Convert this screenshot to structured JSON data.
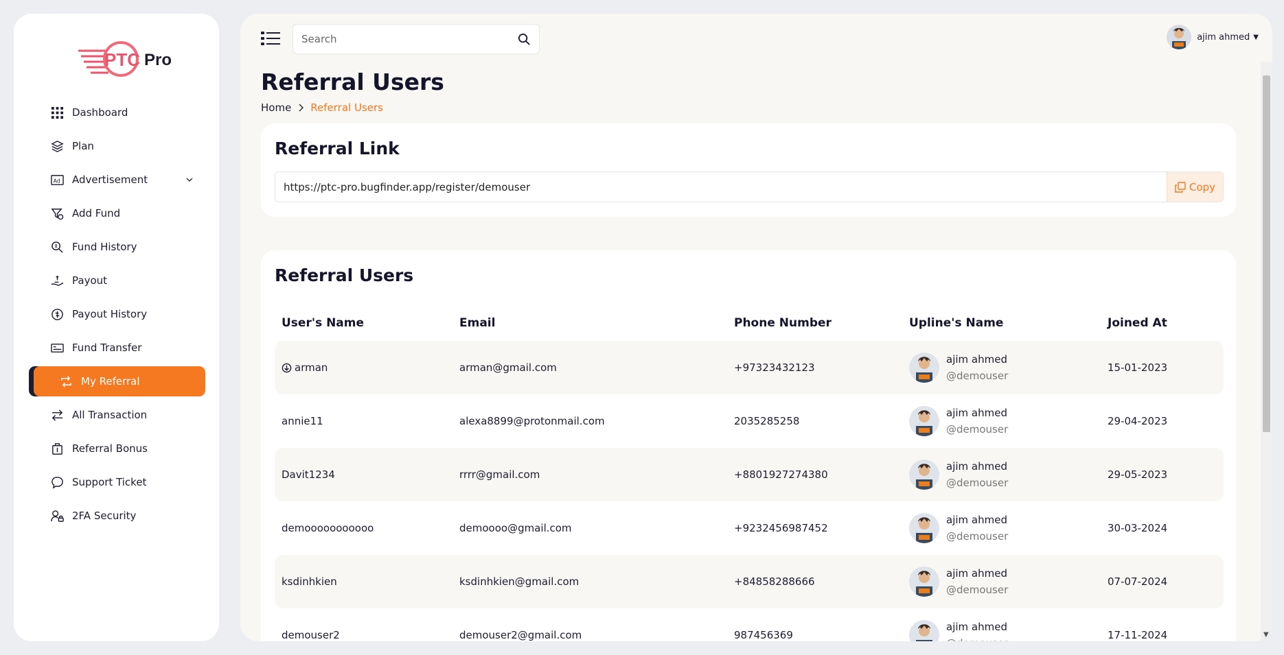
{
  "brand": {
    "logo_left": "PTC",
    "logo_right": "Pro",
    "accent": "#f47920",
    "dark": "#1c1c2e"
  },
  "sidebar": {
    "items": [
      {
        "label": "Dashboard",
        "icon": "grid-icon"
      },
      {
        "label": "Plan",
        "icon": "layers-icon"
      },
      {
        "label": "Advertisement",
        "icon": "ad-icon"
      },
      {
        "label": "Add Fund",
        "icon": "funnel-dollar-icon"
      },
      {
        "label": "Fund History",
        "icon": "search-dollar-icon"
      },
      {
        "label": "Payout",
        "icon": "hand-money-icon"
      },
      {
        "label": "Payout History",
        "icon": "coin-history-icon"
      },
      {
        "label": "Fund Transfer",
        "icon": "money-card-icon"
      },
      {
        "label": "My Referral",
        "icon": "referral-arrows-icon",
        "active": true
      },
      {
        "label": "All Transaction",
        "icon": "exchange-icon"
      },
      {
        "label": "Referral Bonus",
        "icon": "bonus-bag-icon"
      },
      {
        "label": "Support Ticket",
        "icon": "chat-icon"
      },
      {
        "label": "2FA Security",
        "icon": "user-lock-icon"
      }
    ]
  },
  "topbar": {
    "search_placeholder": "Search",
    "user_name": "ajim ahmed"
  },
  "page": {
    "title": "Referral Users",
    "breadcrumb_home": "Home",
    "breadcrumb_current": "Referral Users"
  },
  "referral_link": {
    "title": "Referral Link",
    "url": "https://ptc-pro.bugfinder.app/register/demouser",
    "copy_label": "Copy"
  },
  "referral_users": {
    "title": "Referral Users",
    "columns": [
      "User's Name",
      "Email",
      "Phone Number",
      "Upline's Name",
      "Joined At"
    ],
    "rows": [
      {
        "name": "arman",
        "email": "arman@gmail.com",
        "phone": "+97323432123",
        "upline_name": "ajim ahmed",
        "upline_handle": "@demouser",
        "joined": "15-01-2023",
        "has_icon": true
      },
      {
        "name": "annie11",
        "email": "alexa8899@protonmail.com",
        "phone": "2035285258",
        "upline_name": "ajim ahmed",
        "upline_handle": "@demouser",
        "joined": "29-04-2023"
      },
      {
        "name": "Davit1234",
        "email": "rrrr@gmail.com",
        "phone": "+8801927274380",
        "upline_name": "ajim ahmed",
        "upline_handle": "@demouser",
        "joined": "29-05-2023"
      },
      {
        "name": "demooooooooooo",
        "email": "demoooo@gmail.com",
        "phone": "+9232456987452",
        "upline_name": "ajim ahmed",
        "upline_handle": "@demouser",
        "joined": "30-03-2024"
      },
      {
        "name": "ksdinhkien",
        "email": "ksdinhkien@gmail.com",
        "phone": "+84858288666",
        "upline_name": "ajim ahmed",
        "upline_handle": "@demouser",
        "joined": "07-07-2024"
      },
      {
        "name": "demouser2",
        "email": "demouser2@gmail.com",
        "phone": "987456369",
        "upline_name": "ajim ahmed",
        "upline_handle": "@demouser",
        "joined": "17-11-2024"
      }
    ]
  }
}
